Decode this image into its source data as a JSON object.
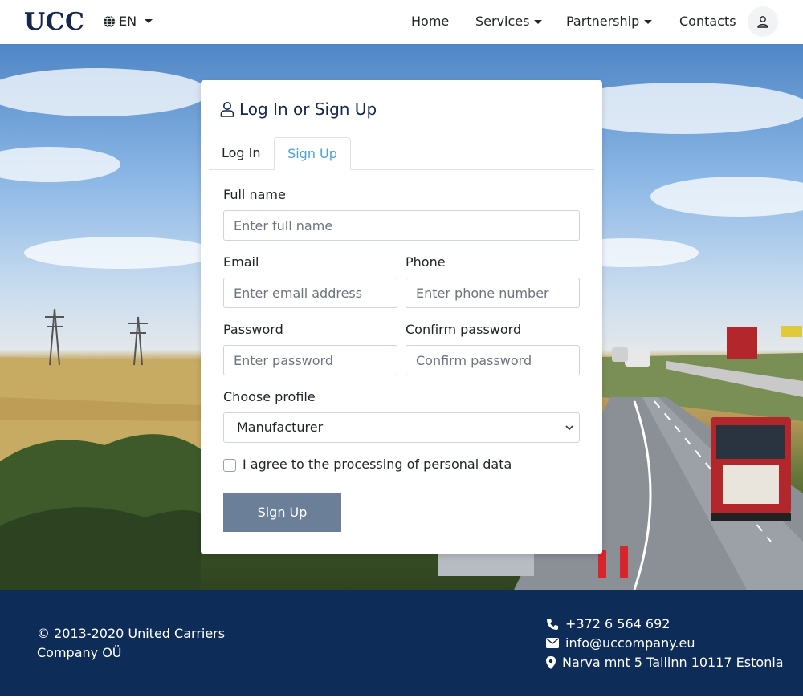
{
  "navbar": {
    "brand": "UCC",
    "language": "EN",
    "items": [
      {
        "label": "Home",
        "has_dropdown": false
      },
      {
        "label": "Services",
        "has_dropdown": true
      },
      {
        "label": "Partnership",
        "has_dropdown": true
      },
      {
        "label": "Contacts",
        "has_dropdown": false
      }
    ],
    "icons": {
      "language": "globe-icon",
      "account": "user-icon"
    }
  },
  "card": {
    "title": "Log In or Sign Up",
    "tabs": [
      {
        "label": "Log In",
        "active": false
      },
      {
        "label": "Sign Up",
        "active": true
      }
    ],
    "form": {
      "full_name": {
        "label": "Full name",
        "placeholder": "Enter full name",
        "value": ""
      },
      "email": {
        "label": "Email",
        "placeholder": "Enter email address",
        "value": ""
      },
      "phone": {
        "label": "Phone",
        "placeholder": "Enter phone number",
        "value": ""
      },
      "password": {
        "label": "Password",
        "placeholder": "Enter password",
        "value": ""
      },
      "confirm_password": {
        "label": "Confirm password",
        "placeholder": "Confirm password",
        "value": ""
      },
      "profile": {
        "label": "Choose profile",
        "selected": "Manufacturer"
      },
      "consent": {
        "label": "I agree to the processing of personal data",
        "checked": false
      },
      "submit_label": "Sign Up"
    }
  },
  "footer": {
    "copyright": "© 2013-2020 United Carriers Company OÜ",
    "phone": "+372 6 564 692",
    "email": "info@uccompany.eu",
    "address": "Narva mnt 5 Tallinn 10117 Estonia"
  },
  "colors": {
    "brand": "#14284b",
    "footer_bg": "#0d2c57",
    "active_tab": "#4aa3d8",
    "submit_bg": "#6b7f99"
  }
}
